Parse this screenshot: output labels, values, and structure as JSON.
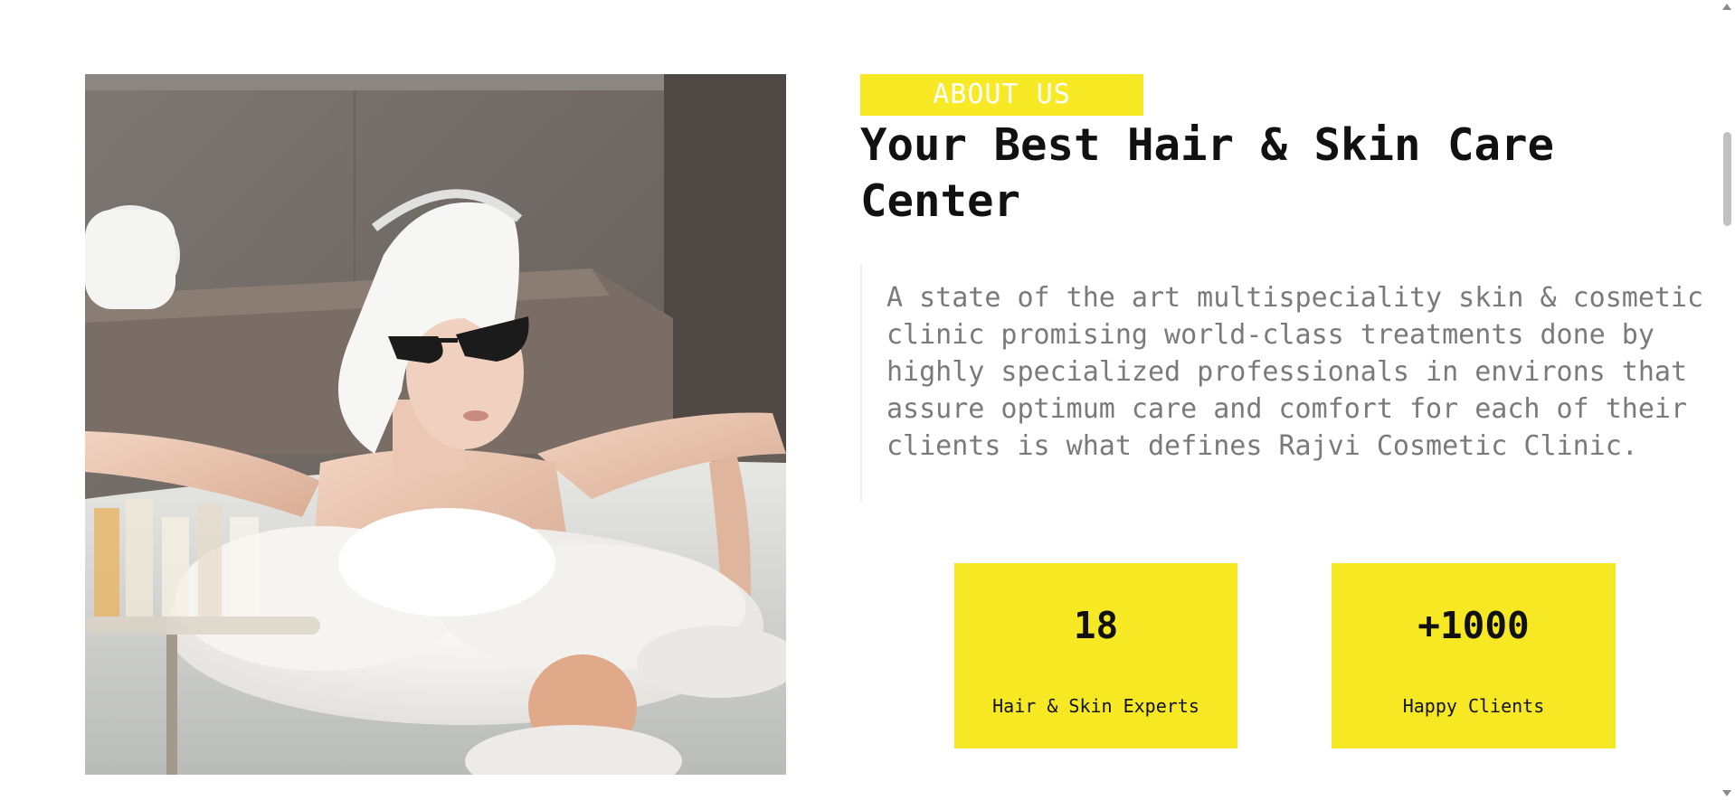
{
  "about": {
    "tag": "ABOUT US",
    "headline": "Your Best Hair & Skin Care Center",
    "description": "A state of the art multispeciality skin & cosmetic clinic promising world-class treatments done by highly specialized professionals in environs that assure optimum care and comfort for each of their clients is what defines Rajvi Cosmetic Clinic."
  },
  "stats": [
    {
      "value": "18",
      "label": "Hair & Skin Experts"
    },
    {
      "value": "+1000",
      "label": "Happy Clients"
    }
  ],
  "colors": {
    "accent": "#f6e924",
    "text": "#111111",
    "muted": "#7a7a7a"
  },
  "photo": {
    "subject": "woman-in-bubble-bath-icon"
  }
}
